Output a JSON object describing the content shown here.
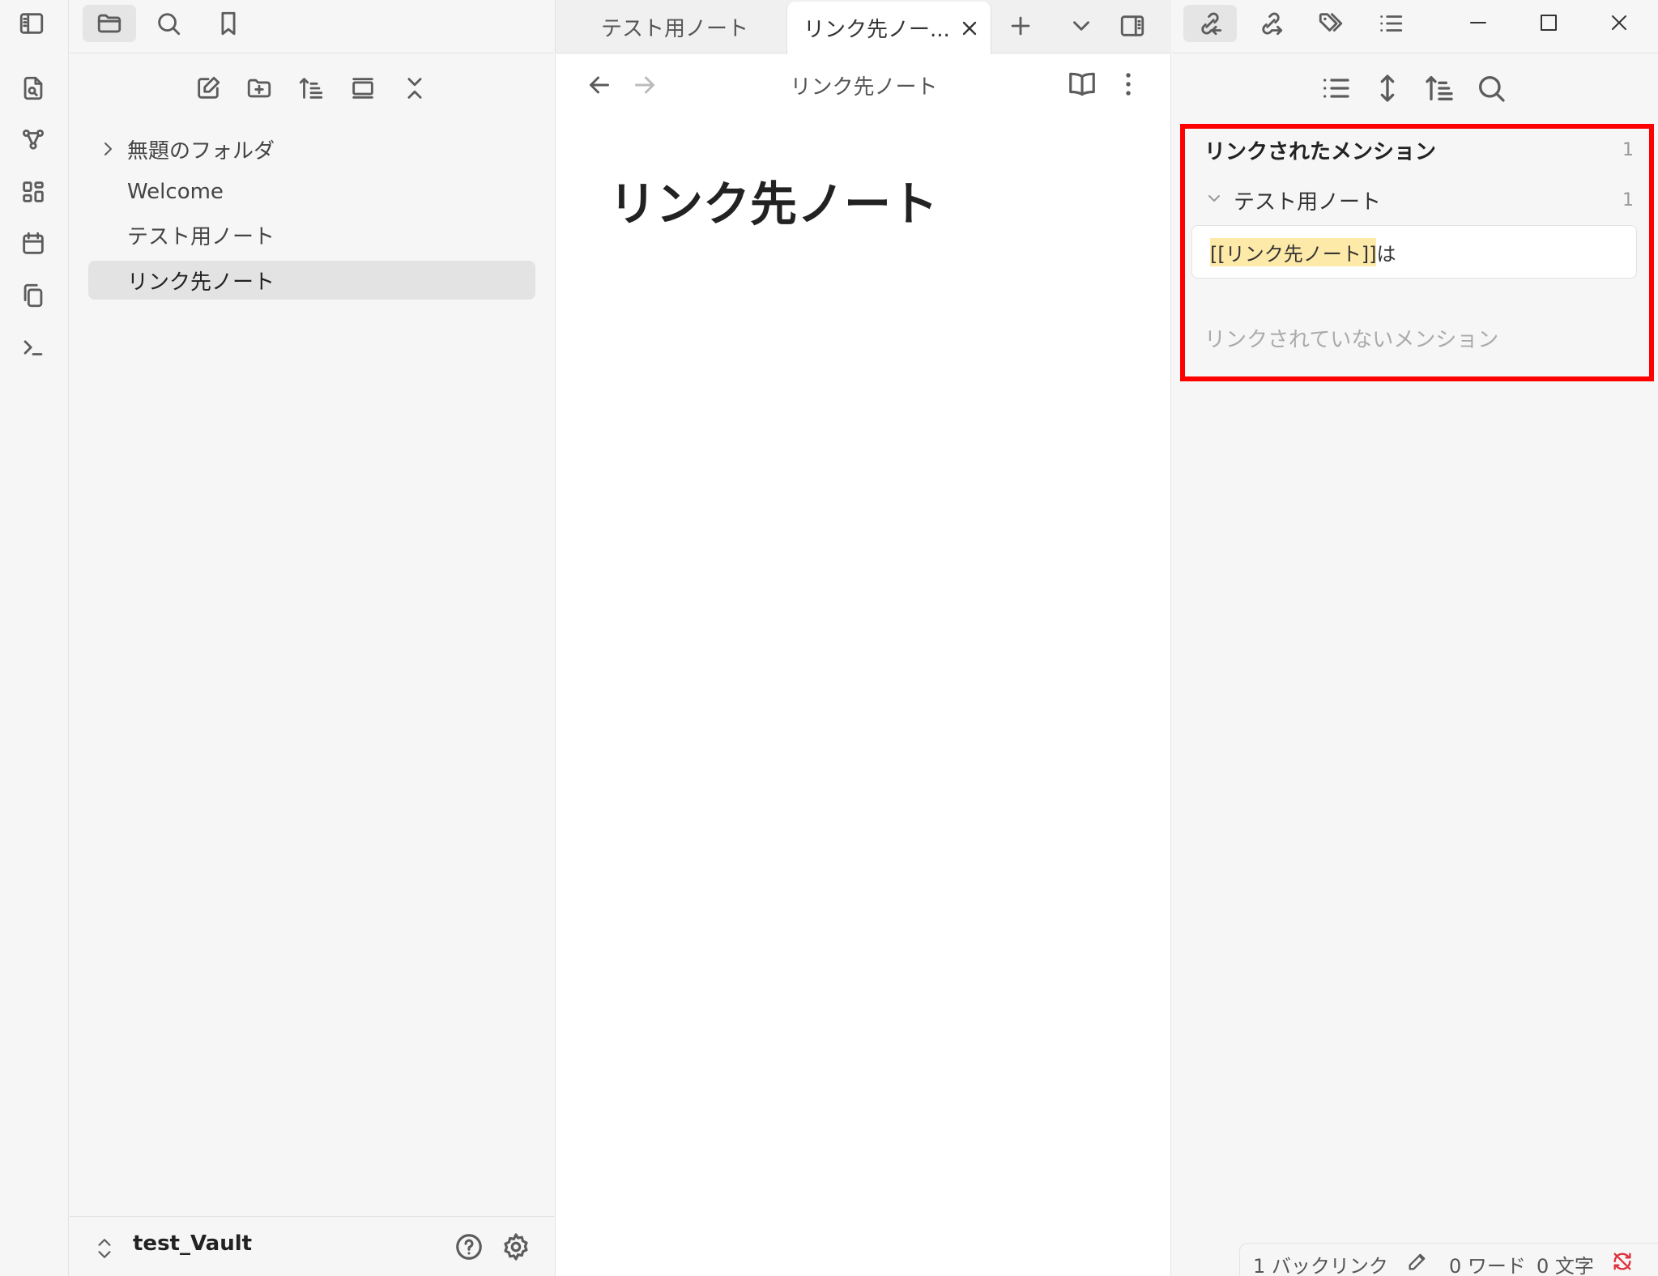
{
  "tabs": [
    {
      "label": "テスト用ノート"
    },
    {
      "label": "リンク先ノー..."
    }
  ],
  "explorer": {
    "items": [
      {
        "label": "無題のフォルダ",
        "type": "folder"
      },
      {
        "label": "Welcome",
        "type": "file"
      },
      {
        "label": "テスト用ノート",
        "type": "file"
      },
      {
        "label": "リンク先ノート",
        "type": "file",
        "active": true
      }
    ],
    "vault_name": "test_Vault"
  },
  "editor": {
    "view_title": "リンク先ノート",
    "heading": "リンク先ノート"
  },
  "backlinks": {
    "linked_heading": "リンクされたメンション",
    "linked_count": "1",
    "file_name": "テスト用ノート",
    "file_count": "1",
    "snippet_link": "[[リンク先ノート]]",
    "snippet_rest": "は",
    "unlinked_heading": "リンクされていないメンション"
  },
  "statusbar": {
    "backlinks": "1 バックリンク",
    "words": "0 ワード",
    "chars": "0 文字"
  },
  "colors": {
    "highlight_frame": "#ff0000",
    "link_highlight": "#fde9a8"
  }
}
